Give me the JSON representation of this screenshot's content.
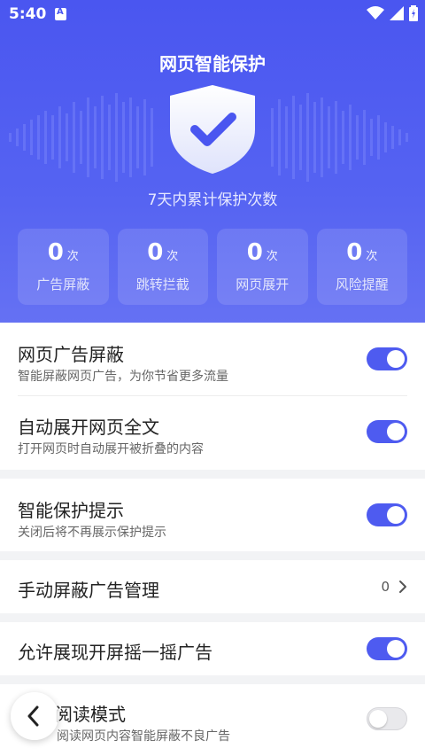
{
  "status_bar": {
    "time": "5:40"
  },
  "header": {
    "title": "网页智能保护",
    "subtitle": "7天内累计保护次数"
  },
  "stats": [
    {
      "value": "0",
      "unit": "次",
      "label": "广告屏蔽"
    },
    {
      "value": "0",
      "unit": "次",
      "label": "跳转拦截"
    },
    {
      "value": "0",
      "unit": "次",
      "label": "网页展开"
    },
    {
      "value": "0",
      "unit": "次",
      "label": "风险提醒"
    }
  ],
  "settings": {
    "ad_block": {
      "label": "网页广告屏蔽",
      "desc": "智能屏蔽网页广告，为你节省更多流量",
      "enabled": true
    },
    "auto_expand": {
      "label": "自动展开网页全文",
      "desc": "打开网页时自动展开被折叠的内容",
      "enabled": true
    },
    "protect_tip": {
      "label": "智能保护提示",
      "desc": "关闭后将不再展示保护提示",
      "enabled": true
    },
    "manual_block": {
      "label": "手动屏蔽广告管理",
      "count": "0"
    },
    "shake_ad": {
      "label": "允许展现开屏摇一摇广告",
      "enabled": true
    },
    "pure_read": {
      "label": "阅读模式",
      "desc": "阅读网页内容智能屏蔽不良广告",
      "enabled": false
    }
  },
  "colors": {
    "accent": "#4e5bf0",
    "hero_top": "#4a56f0"
  }
}
